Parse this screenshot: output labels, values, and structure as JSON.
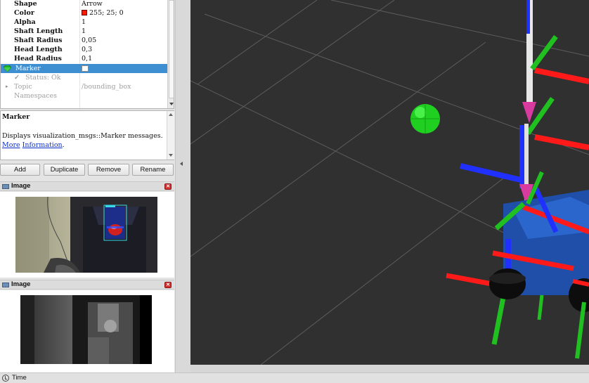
{
  "properties": {
    "rows": [
      {
        "key": "Shape",
        "value": "Arrow"
      },
      {
        "key": "Color",
        "value": "255; 25; 0"
      },
      {
        "key": "Alpha",
        "value": "1"
      },
      {
        "key": "Shaft Length",
        "value": "1"
      },
      {
        "key": "Shaft Radius",
        "value": "0,05"
      },
      {
        "key": "Head Length",
        "value": "0,3"
      },
      {
        "key": "Head Radius",
        "value": "0,1"
      }
    ],
    "marker": {
      "label": "Marker"
    },
    "status": {
      "label": "Status: Ok"
    },
    "topic": {
      "key": "Topic",
      "value": "/bounding_box"
    },
    "namespaces": {
      "key": "Namespaces"
    },
    "color_swatch": "#ff1900"
  },
  "description": {
    "title": "Marker",
    "text": "Displays visualization_msgs::Marker messages.",
    "link_more": "More",
    "link_info": "Information"
  },
  "buttons": {
    "add": "Add",
    "duplicate": "Duplicate",
    "remove": "Remove",
    "rename": "Rename"
  },
  "image_panels": [
    {
      "title": "Image"
    },
    {
      "title": "Image"
    }
  ],
  "timebar": {
    "label": "Time"
  },
  "colors": {
    "selection": "#3d8fd1",
    "viewport_bg": "#303030",
    "axis_red": "#ff1a1a",
    "axis_green": "#1fbf1f",
    "axis_blue": "#1f2fff"
  }
}
